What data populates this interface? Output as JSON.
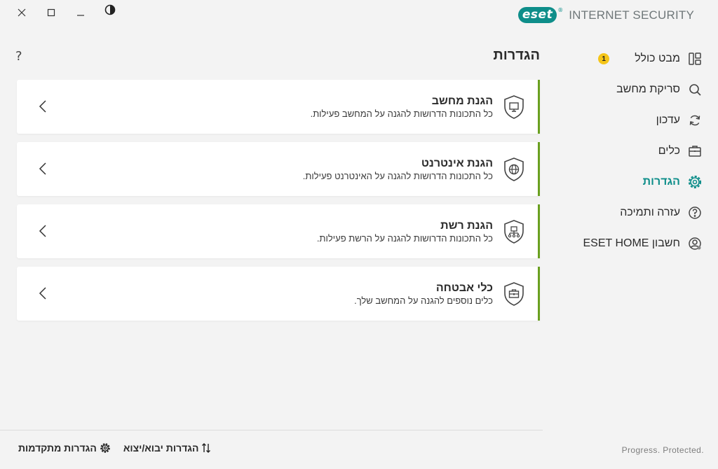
{
  "brand": {
    "logo_text": "eset",
    "logo_mark": "®",
    "product": "INTERNET SECURITY",
    "accent": "#0e8e8a"
  },
  "window": {
    "close_icon": "close-icon",
    "maximize_icon": "maximize-icon",
    "minimize_icon": "minimize-icon",
    "theme_icon": "contrast-icon"
  },
  "sidebar": {
    "items": [
      {
        "label": "מבט כולל",
        "icon": "dashboard-icon",
        "badge": "1"
      },
      {
        "label": "סריקת מחשב",
        "icon": "search-icon"
      },
      {
        "label": "עדכון",
        "icon": "refresh-icon"
      },
      {
        "label": "כלים",
        "icon": "briefcase-icon"
      },
      {
        "label": "הגדרות",
        "icon": "gear-icon",
        "active": true
      },
      {
        "label": "עזרה ותמיכה",
        "icon": "help-icon"
      },
      {
        "label": "חשבון ESET HOME",
        "icon": "account-icon"
      }
    ]
  },
  "main": {
    "title": "הגדרות",
    "help_label": "?",
    "cards": [
      {
        "title": "הגנת מחשב",
        "desc": "כל התכונות הדרושות להגנה על המחשב פעילות.",
        "icon": "computer-shield-icon"
      },
      {
        "title": "הגנת אינטרנט",
        "desc": "כל התכונות הדרושות להגנה על האינטרנט פעילות.",
        "icon": "globe-shield-icon"
      },
      {
        "title": "הגנת רשת",
        "desc": "כל התכונות הדרושות להגנה על הרשת פעילות.",
        "icon": "network-shield-icon"
      },
      {
        "title": "כלי אבטחה",
        "desc": "כלים נוספים להגנה על המחשב שלך.",
        "icon": "toolbox-shield-icon"
      }
    ]
  },
  "footer": {
    "advanced": "הגדרות מתקדמות",
    "import_export": "הגדרות יבוא/יצוא",
    "tagline": "Progress. Protected."
  },
  "colors": {
    "status_green": "#6aa020",
    "badge_yellow": "#f5c518"
  }
}
